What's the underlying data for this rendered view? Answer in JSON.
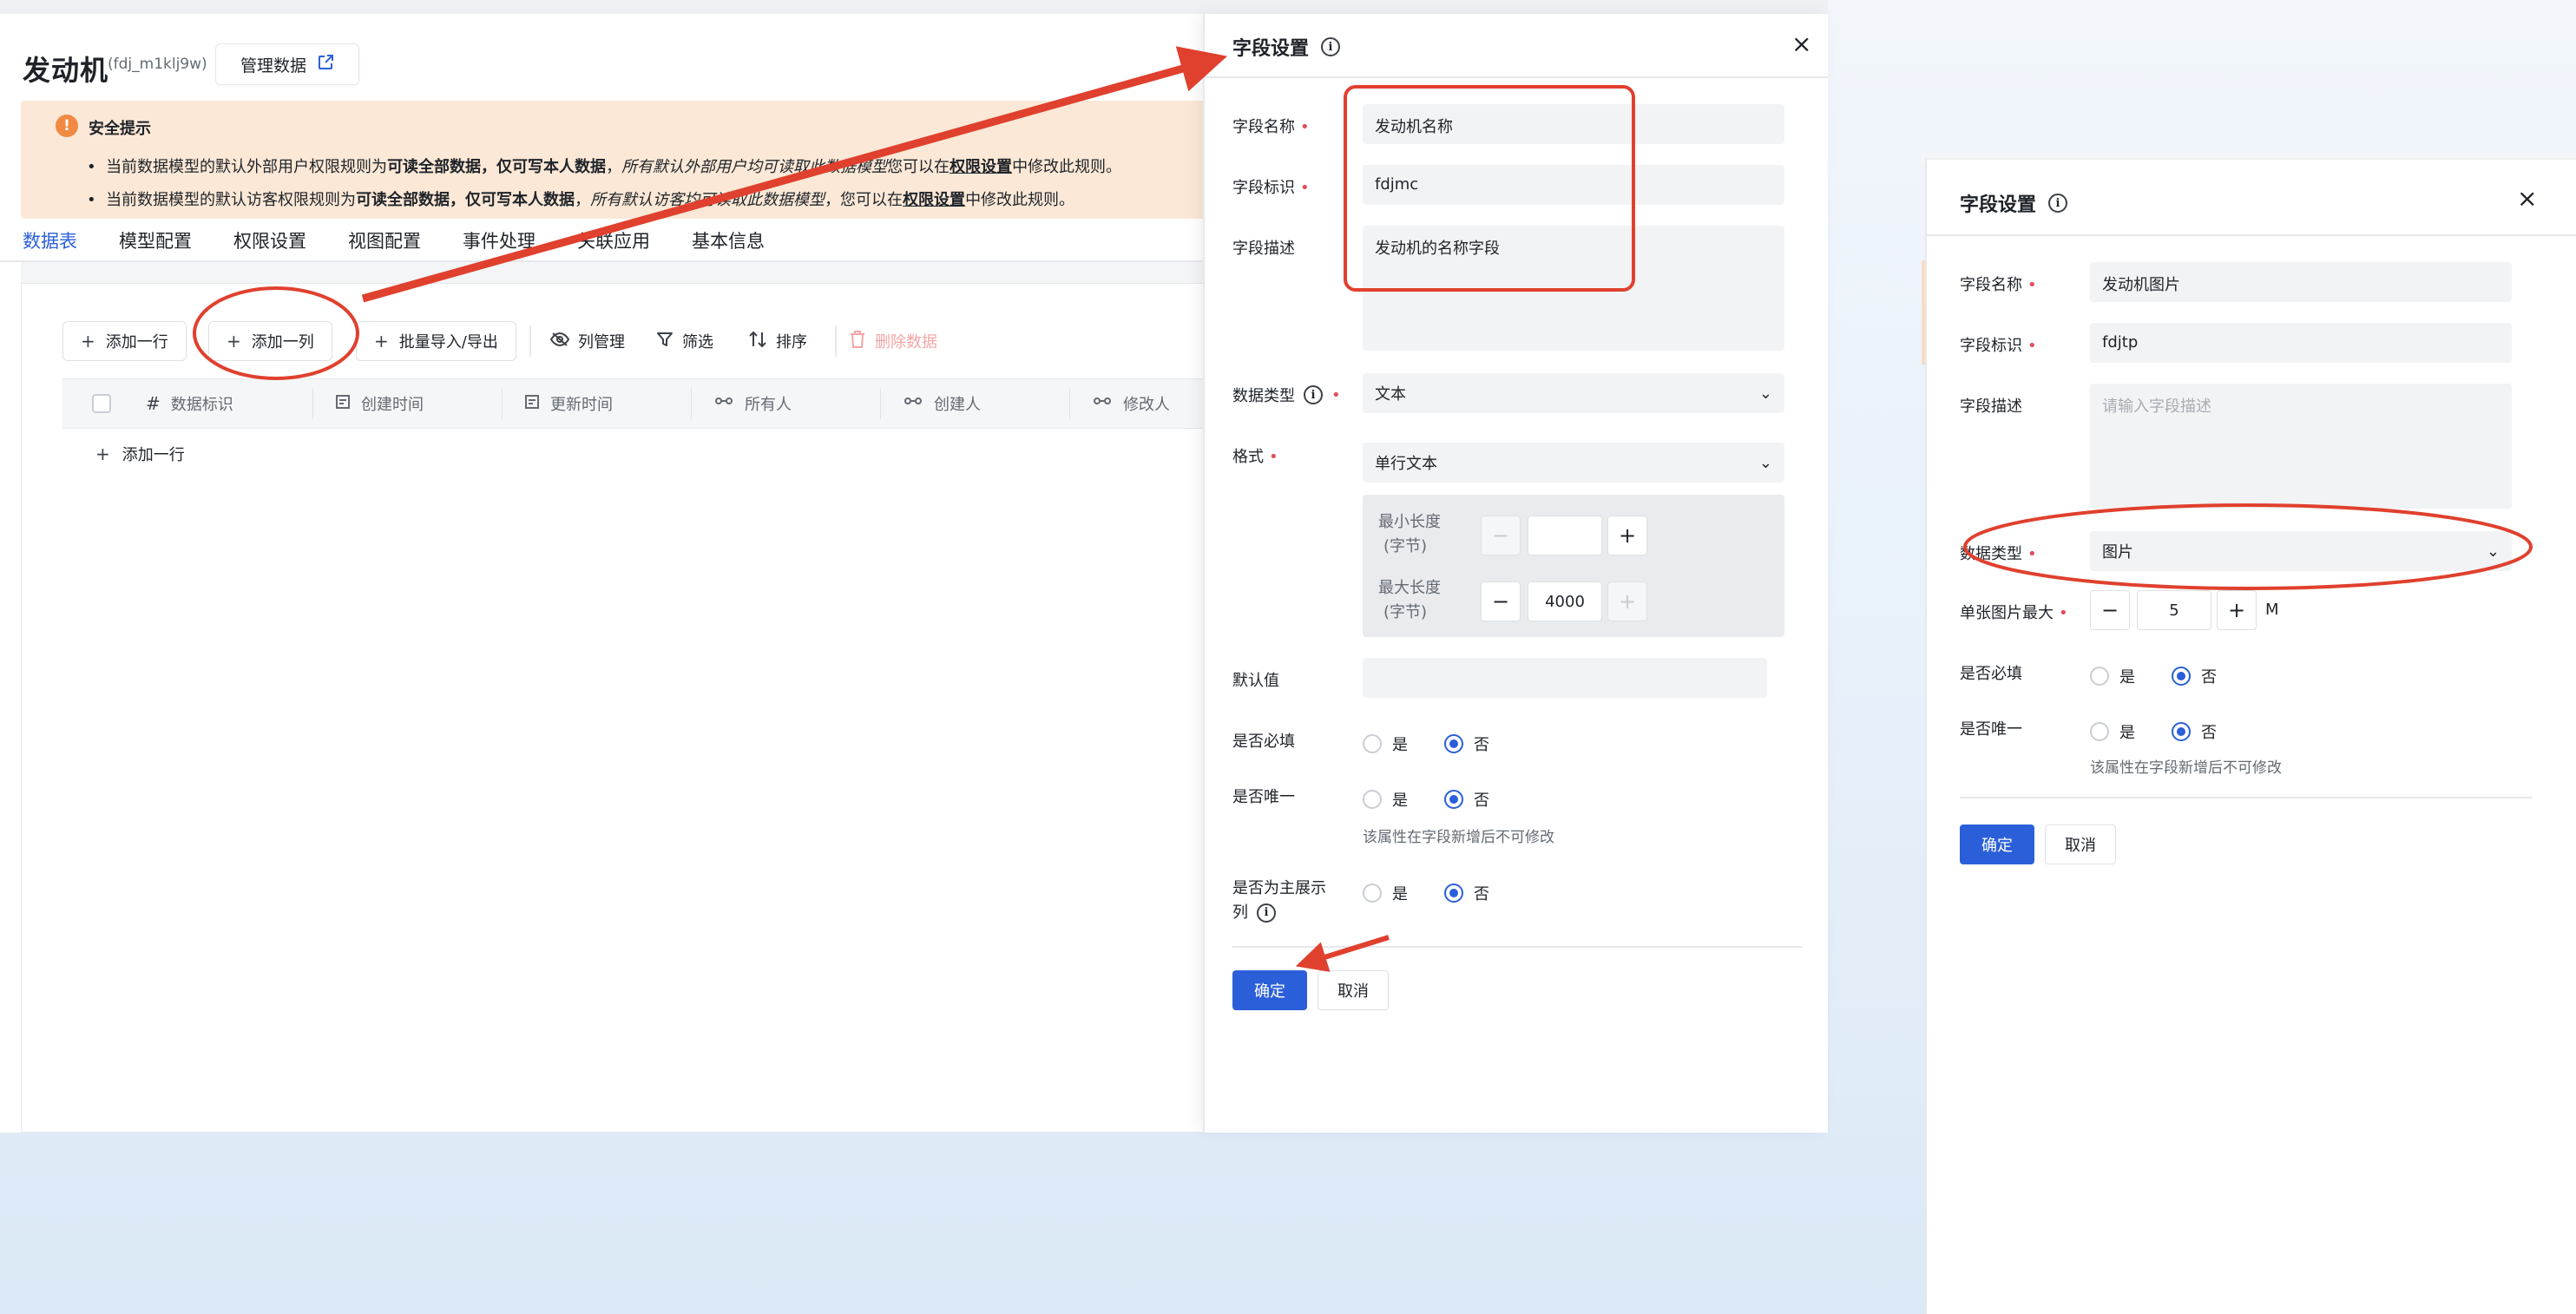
{
  "left": {
    "title": "发动机",
    "subtitle": "(fdj_m1klj9w)",
    "manage_label": "管理数据",
    "notice": {
      "title": "安全提示",
      "line1": {
        "a": "当前数据模型的默认外部用户权限规则为",
        "b": "可读全部数据，仅可写本人数据",
        "c": "，",
        "d": "所有默认外部用户均可读取此数据模型",
        "e": "您可以在",
        "f": "权限设置",
        "g": "中修改此规则。"
      },
      "line2": {
        "a": "当前数据模型的默认访客权限规则为",
        "b": "可读全部数据，仅可写本人数据",
        "c": "，",
        "d": "所有默认访客均可读取此数据模型",
        "e": "，您可以在",
        "f": "权限设置",
        "g": "中修改此规则。"
      }
    },
    "tabs": [
      "数据表",
      "模型配置",
      "权限设置",
      "视图配置",
      "事件处理",
      "关联应用",
      "基本信息"
    ],
    "toolbar": {
      "add_row": "添加一行",
      "add_col": "添加一列",
      "batch": "批量导入/导出",
      "columns": "列管理",
      "filter": "筛选",
      "sort": "排序",
      "delete": "删除数据"
    },
    "table_headers": [
      "数据标识",
      "创建时间",
      "更新时间",
      "所有人",
      "创建人",
      "修改人"
    ],
    "add_row_bottom": "添加一行"
  },
  "panel_a": {
    "title": "字段设置",
    "name_label": "字段名称",
    "name_value": "发动机名称",
    "id_label": "字段标识",
    "id_value": "fdjmc",
    "desc_label": "字段描述",
    "desc_value": "发动机的名称字段",
    "type_label": "数据类型",
    "type_value": "文本",
    "format_label": "格式",
    "format_value": "单行文本",
    "min_label_1": "最小长度",
    "min_label_2": "(字节)",
    "min_value": "",
    "max_label_1": "最大长度",
    "max_label_2": "(字节)",
    "max_value": "4000",
    "default_label": "默认值",
    "required_label": "是否必填",
    "unique_label": "是否唯一",
    "primary_label_1": "是否为主展示",
    "primary_label_2": "列",
    "yes": "是",
    "no": "否",
    "unique_hint": "该属性在字段新增后不可修改",
    "ok": "确定",
    "cancel": "取消"
  },
  "panel_b": {
    "title": "字段设置",
    "name_label": "字段名称",
    "name_value": "发动机图片",
    "id_label": "字段标识",
    "id_value": "fdjtp",
    "desc_label": "字段描述",
    "desc_placeholder": "请输入字段描述",
    "type_label": "数据类型",
    "type_value": "图片",
    "size_label": "单张图片最大",
    "size_value": "5",
    "size_unit": "M",
    "required_label": "是否必填",
    "unique_label": "是否唯一",
    "yes": "是",
    "no": "否",
    "unique_hint": "该属性在字段新增后不可修改",
    "ok": "确定",
    "cancel": "取消"
  },
  "colors": {
    "accent": "#2b5fd9",
    "warning_bg": "#fbe8d6",
    "warning_icon": "#f08a43",
    "annotation_red": "#e0402e",
    "required_star": "#e34d59"
  }
}
